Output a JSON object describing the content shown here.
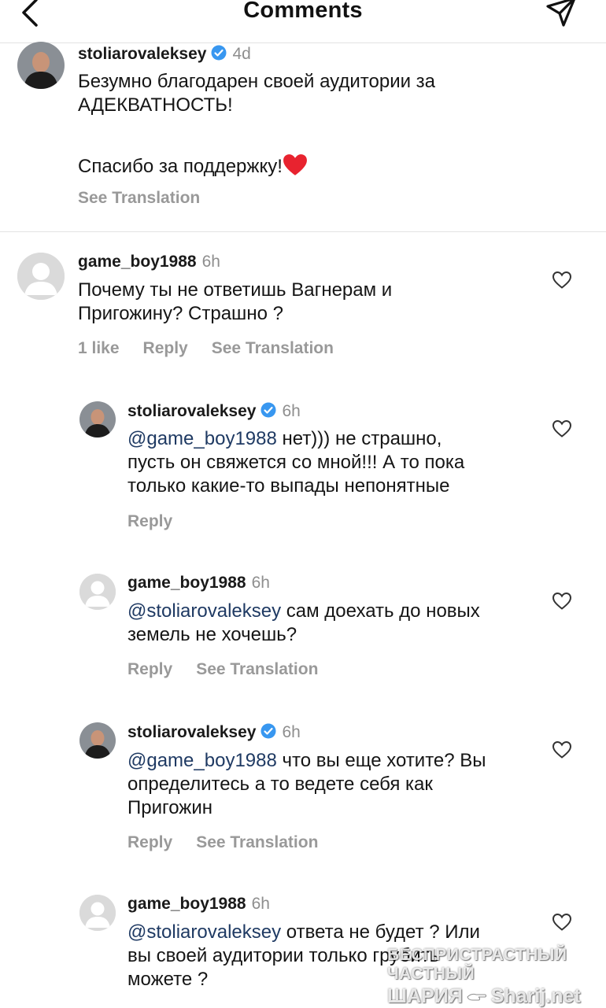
{
  "header": {
    "title": "Comments"
  },
  "caption": {
    "username": "stoliarovaleksey",
    "time": "4d",
    "line1": "Безумно благодарен своей аудитории за",
    "line2": "АДЕКВАТНОСТЬ!",
    "line3": "Спасибо за поддержку!",
    "see_translation": "See Translation"
  },
  "comments": [
    {
      "username": "game_boy1988",
      "time": "6h",
      "lines": [
        "Почему ты не ответишь Вагнерам и",
        "Пригожину? Страшно ?"
      ],
      "likes": "1 like",
      "reply": "Reply",
      "see_translation": "See Translation"
    },
    {
      "username": "stoliarovaleksey",
      "time": "6h",
      "mention": "@game_boy1988",
      "lines": [
        " нет))) не страшно,",
        "пусть он свяжется со мной!!! А то пока",
        "только какие-то выпады непонятные"
      ],
      "reply": "Reply"
    },
    {
      "username": "game_boy1988",
      "time": "6h",
      "mention": "@stoliarovaleksey",
      "lines": [
        " сам доехать до новых",
        "земель не хочешь?"
      ],
      "reply": "Reply",
      "see_translation": "See Translation"
    },
    {
      "username": "stoliarovaleksey",
      "time": "6h",
      "mention": "@game_boy1988",
      "lines": [
        " что вы еще хотите? Вы",
        "определитесь а то ведете себя как",
        "Пригожин"
      ],
      "reply": "Reply",
      "see_translation": "See Translation"
    },
    {
      "username": "game_boy1988",
      "time": "6h",
      "mention": "@stoliarovaleksey",
      "lines": [
        " ответа не будет ? Или",
        "вы своей аудитории только грубить",
        "можете ?"
      ]
    }
  ],
  "watermark": {
    "line1": "БЕСПРИСТРАСТНЫЙ ЧАСТНЫЙ",
    "line2a": "ШАРИЯ",
    "line2b": "Sharij.net"
  },
  "colors": {
    "mention": "#1f3a63",
    "verified": "#3897f0",
    "heart_red": "#e8232f",
    "muted": "#8e8e8e"
  }
}
